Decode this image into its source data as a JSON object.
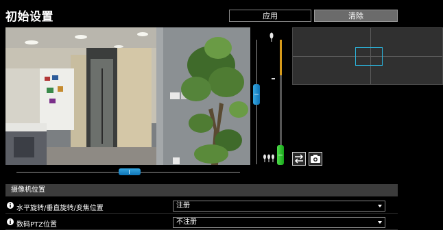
{
  "page": {
    "title": "初始设置"
  },
  "toolbar": {
    "apply_label": "应用",
    "clear_label": "清除"
  },
  "controls": {
    "pan_position": 0.5,
    "tilt_position": 0.4,
    "zoom_position": 0.95,
    "swap_icon": "swap-arrows-icon",
    "snapshot_icon": "camera-icon",
    "wide_icon": "single-tree-icon",
    "tele_icon": "three-trees-icon"
  },
  "colors": {
    "slider_blue": "#1f8fd0",
    "zoom_green": "#23c51f",
    "zoom_accent": "#d69a1a",
    "minimap_box": "#2bb4dc"
  },
  "camera_position": {
    "header": "摄像机位置",
    "rows": [
      {
        "label": "水平旋转/垂直旋转/变焦位置",
        "value": "注册",
        "icon": "info-icon"
      },
      {
        "label": "数码PTZ位置",
        "value": "不注册",
        "icon": "info-icon"
      }
    ]
  }
}
